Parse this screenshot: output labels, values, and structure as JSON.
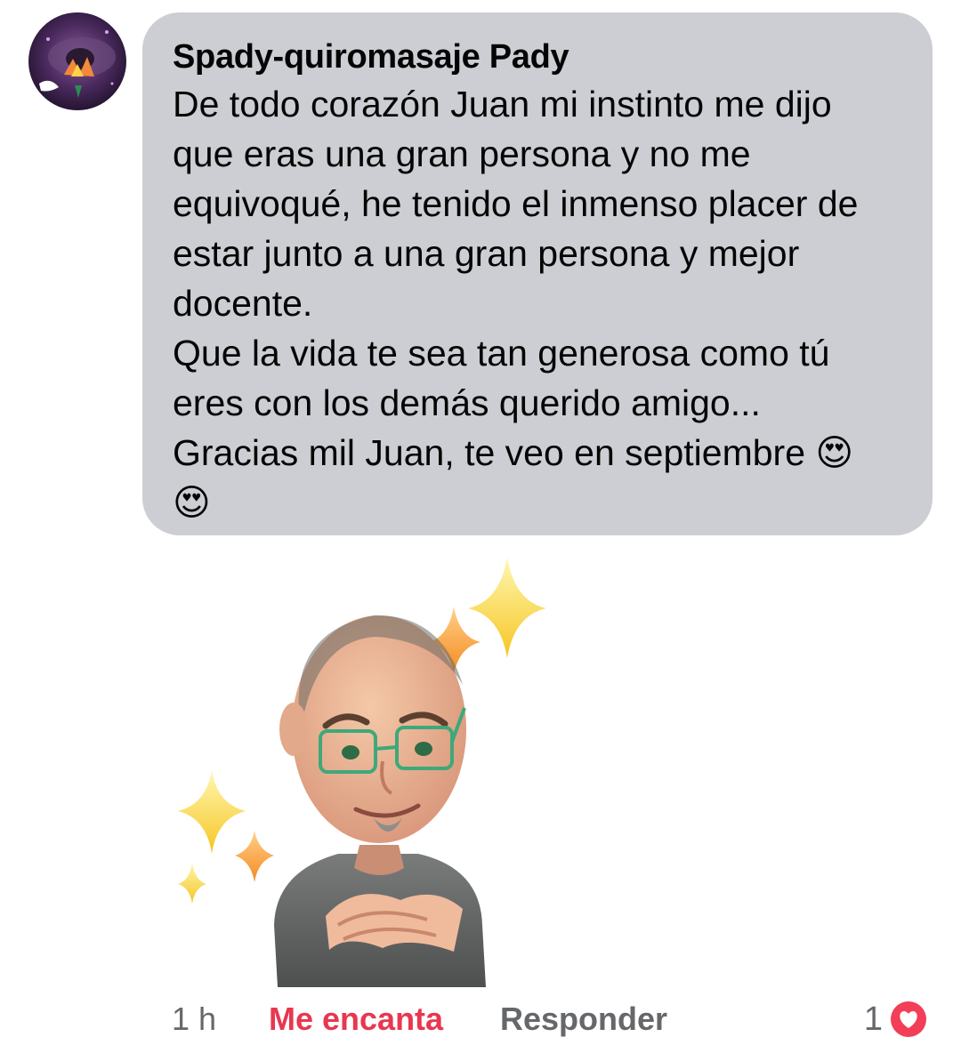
{
  "comment": {
    "author": "Spady-quiromasaje Pady",
    "lines": [
      "De todo corazón Juan mi instinto me dijo",
      "que eras una gran persona y no me",
      "equivoqué, he tenido el inmenso placer de",
      "estar junto a una gran persona y mejor",
      "docente.",
      "Que la vida te sea tan generosa como tú",
      "eres con los demás querido amigo...",
      "Gracias mil Juan, te veo en septiembre 😍",
      "😍"
    ],
    "attachment_icon": "avatar-sticker-grateful"
  },
  "footer": {
    "time": "1 h",
    "reaction_label": "Me encanta",
    "reply_label": "Responder",
    "reaction_count": "1",
    "reaction_icon": "heart-icon"
  },
  "colors": {
    "bubble": "#ccced3",
    "reaction_active": "#e8374f",
    "muted": "#65676b",
    "heart": "#f33e58"
  }
}
